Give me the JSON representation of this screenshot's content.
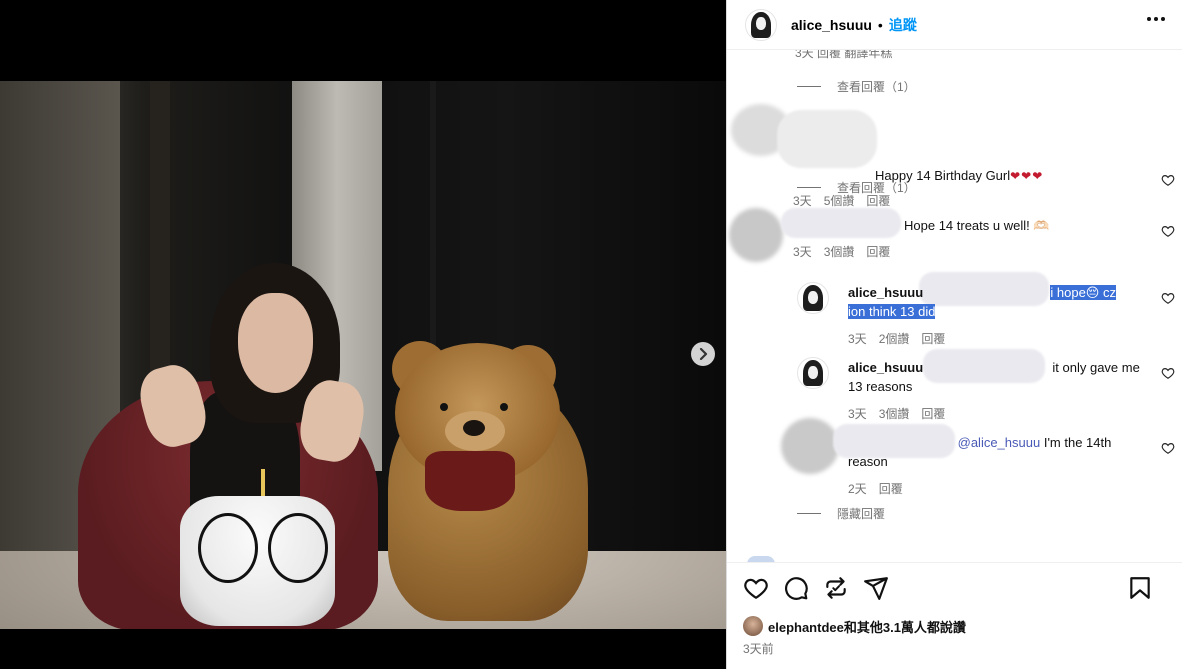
{
  "media": {
    "carousel_dots": 6,
    "active_dot": 1
  },
  "post_header": {
    "username": "alice_hsuuu",
    "separator": "•",
    "follow_label": "追蹤"
  },
  "comments": {
    "top_partial_meta": "3天   回覆   翻譯年糕",
    "threads": [
      {
        "view_replies": "查看回覆（1）"
      },
      {
        "text": "Happy 14 Birthday Gurl",
        "hearts": "❤❤❤",
        "time": "3天",
        "likes": "5個讚",
        "reply": "回覆",
        "view_replies": "查看回覆（1）"
      },
      {
        "text": "Hope 14 treats u well! ",
        "emoji": "🫶🏻",
        "time": "3天",
        "likes": "3個讚",
        "reply": "回覆"
      }
    ],
    "replies": [
      {
        "username": "alice_hsuuu",
        "text_line1": "i hope😔 cz",
        "text_line2": "ion think 13 did",
        "time": "3天",
        "likes": "2個讚",
        "reply": "回覆"
      },
      {
        "username": "alice_hsuuu",
        "text_line1": "it only gave me",
        "text_line2": "13 reasons",
        "time": "3天",
        "likes": "3個讚",
        "reply": "回覆"
      },
      {
        "mention": "@alice_hsuuu",
        "text_line1": " I'm the 14th",
        "text_line2": "reason",
        "time": "2天",
        "reply": "回覆"
      }
    ],
    "hide_replies": "隱藏回覆"
  },
  "likes": {
    "text": "elephantdee和其他3.1萬人都說讚"
  },
  "post_time": "3天前",
  "colors": {
    "link_blue": "#0095f6",
    "selection_blue": "#3a6fd8",
    "meta_gray": "#737373"
  },
  "icons": [
    "heart-icon",
    "comment-icon",
    "repost-icon",
    "share-icon",
    "save-icon",
    "more-icon",
    "chevron-right-icon"
  ]
}
